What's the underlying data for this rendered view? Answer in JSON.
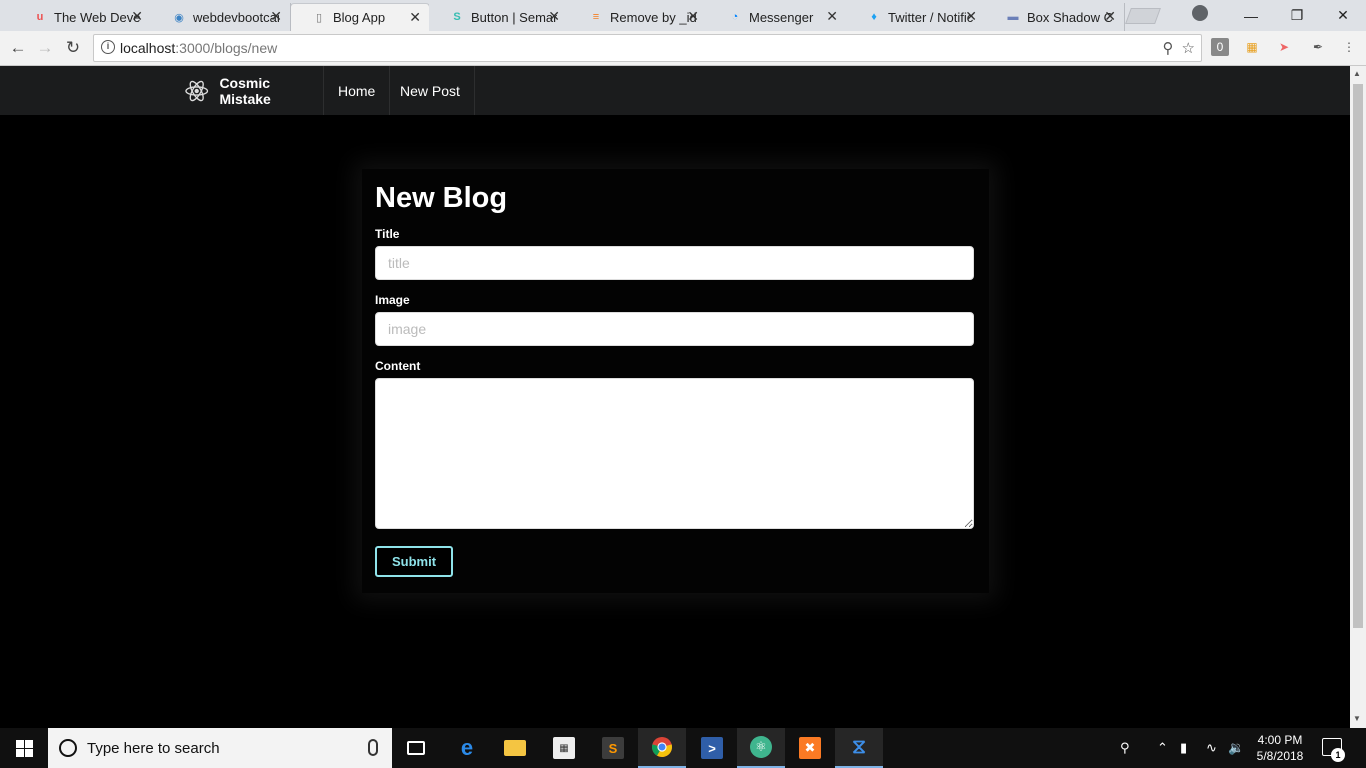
{
  "browser": {
    "tabs": [
      {
        "title": "The Web Devel",
        "icon": "udemy-icon",
        "color": "#ec5252",
        "glyph": "u"
      },
      {
        "title": "webdevbootcar",
        "icon": "eye-icon",
        "color": "#3b82c4",
        "glyph": "◉"
      },
      {
        "title": "Blog App",
        "icon": "page-icon",
        "color": "#777777",
        "glyph": "▯"
      },
      {
        "title": "Button | Seman",
        "icon": "semantic-ui-icon",
        "color": "#35bdb2",
        "glyph": "S"
      },
      {
        "title": "Remove by _id",
        "icon": "stackoverflow-icon",
        "color": "#f48024",
        "glyph": "≡"
      },
      {
        "title": "Messenger",
        "icon": "messenger-icon",
        "color": "#0084ff",
        "glyph": "◔"
      },
      {
        "title": "Twitter / Notific",
        "icon": "twitter-icon",
        "color": "#1da1f2",
        "glyph": "♦"
      },
      {
        "title": "Box Shadow CS",
        "icon": "generic-site-icon",
        "color": "#6b7fb8",
        "glyph": "▬"
      }
    ],
    "url_host": "localhost",
    "url_path": ":3000/blogs/new"
  },
  "site": {
    "brand": "Cosmic Mistake",
    "nav": [
      "Home",
      "New Post"
    ]
  },
  "form": {
    "heading": "New Blog",
    "title_label": "Title",
    "title_placeholder": "title",
    "image_label": "Image",
    "image_placeholder": "image",
    "content_label": "Content",
    "submit_label": "Submit"
  },
  "taskbar": {
    "search_placeholder": "Type here to search",
    "time": "4:00 PM",
    "date": "5/8/2018",
    "notification_count": "1"
  },
  "colors": {
    "submit_accent": "#8fe3ea",
    "nav_bg": "#1b1c1d"
  }
}
